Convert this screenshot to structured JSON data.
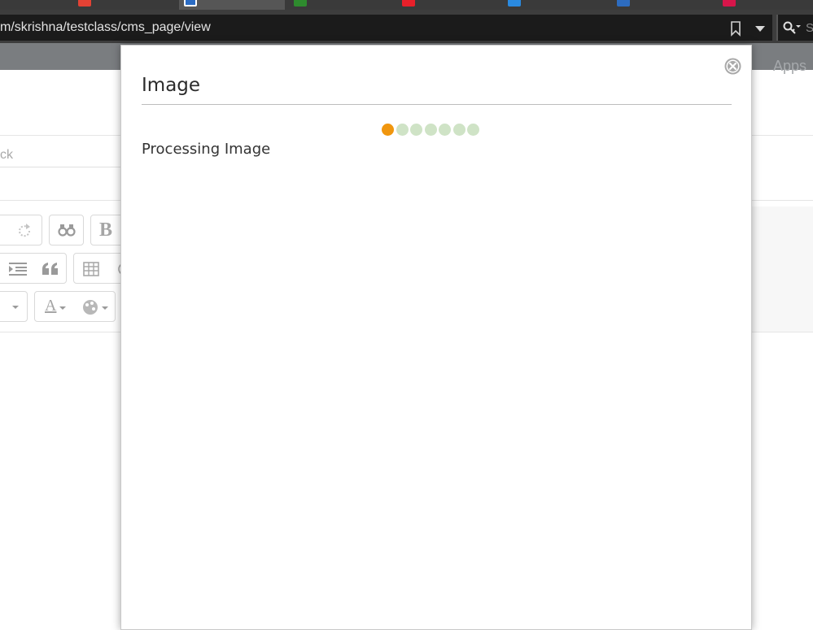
{
  "browser": {
    "url": "m/skrishna/testclass/cms_page/view",
    "search_placeholder": "S",
    "tabs": [
      {
        "favicon_color": "#e34234"
      },
      {
        "favicon_color": "#2b6cc4",
        "active": true
      },
      {
        "favicon_color": "#2e8b2e"
      },
      {
        "favicon_color": "#e8202a"
      },
      {
        "favicon_color": "#2a8ae0"
      },
      {
        "favicon_color": "#2d6cc0"
      },
      {
        "favicon_color": "#d6154a"
      }
    ]
  },
  "page": {
    "apps_link": "Apps",
    "search_placeholder": "ck"
  },
  "modal": {
    "title": "Image",
    "status": "Processing Image",
    "loader": {
      "total_dots": 7,
      "active_index": 0,
      "active_color": "#f0960e",
      "inactive_color": "#cfe3c6"
    }
  }
}
